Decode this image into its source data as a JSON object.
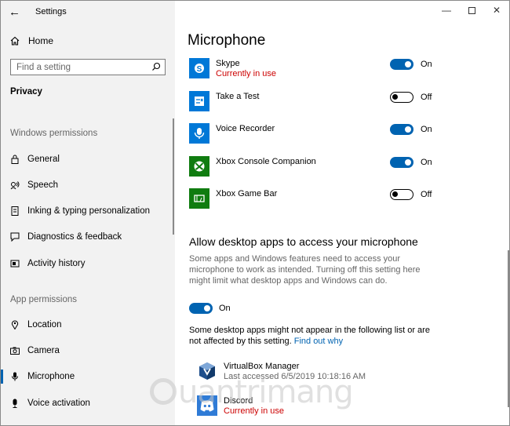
{
  "window": {
    "title": "Settings"
  },
  "sidebar": {
    "home_label": "Home",
    "search_placeholder": "Find a setting",
    "section_label": "Privacy",
    "windows_permissions_header": "Windows permissions",
    "windows_items": [
      {
        "label": "General",
        "icon": "lock-icon"
      },
      {
        "label": "Speech",
        "icon": "speech-icon"
      },
      {
        "label": "Inking & typing personalization",
        "icon": "inking-icon"
      },
      {
        "label": "Diagnostics & feedback",
        "icon": "diagnostics-icon"
      },
      {
        "label": "Activity history",
        "icon": "activity-history-icon"
      }
    ],
    "app_permissions_header": "App permissions",
    "app_items": [
      {
        "label": "Location",
        "icon": "location-icon"
      },
      {
        "label": "Camera",
        "icon": "camera-icon"
      },
      {
        "label": "Microphone",
        "icon": "microphone-icon",
        "selected": true
      },
      {
        "label": "Voice activation",
        "icon": "voice-activation-icon"
      }
    ]
  },
  "main": {
    "title": "Microphone",
    "apps": [
      {
        "name": "Skype",
        "status": "Currently in use",
        "toggle": "On",
        "on": true,
        "icon": "skype-icon"
      },
      {
        "name": "Take a Test",
        "status": "",
        "toggle": "Off",
        "on": false,
        "icon": "take-a-test-icon"
      },
      {
        "name": "Voice Recorder",
        "status": "",
        "toggle": "On",
        "on": true,
        "icon": "voice-recorder-icon"
      },
      {
        "name": "Xbox Console Companion",
        "status": "",
        "toggle": "On",
        "on": true,
        "icon": "xbox-icon"
      },
      {
        "name": "Xbox Game Bar",
        "status": "",
        "toggle": "Off",
        "on": false,
        "icon": "xbox-game-bar-icon"
      }
    ],
    "desktop_section_title": "Allow desktop apps to access your microphone",
    "desktop_description": "Some apps and Windows features need to access your microphone to work as intended. Turning off this setting here might limit what desktop apps and Windows can do.",
    "desktop_toggle_label": "On",
    "desktop_note": "Some desktop apps might not appear in the following list or are not affected by this setting.",
    "find_out_why": "Find out why",
    "desktop_apps": [
      {
        "name": "VirtualBox Manager",
        "status": "Last accessed 6/5/2019 10:18:16 AM",
        "icon": "virtualbox-icon"
      },
      {
        "name": "Discord",
        "status": "Currently in use",
        "icon": "discord-icon"
      }
    ]
  },
  "colors": {
    "accent": "#0063b1",
    "in_use": "#cc0000",
    "sidebar_bg": "#f2f2f2"
  },
  "watermark": "uantrimang"
}
